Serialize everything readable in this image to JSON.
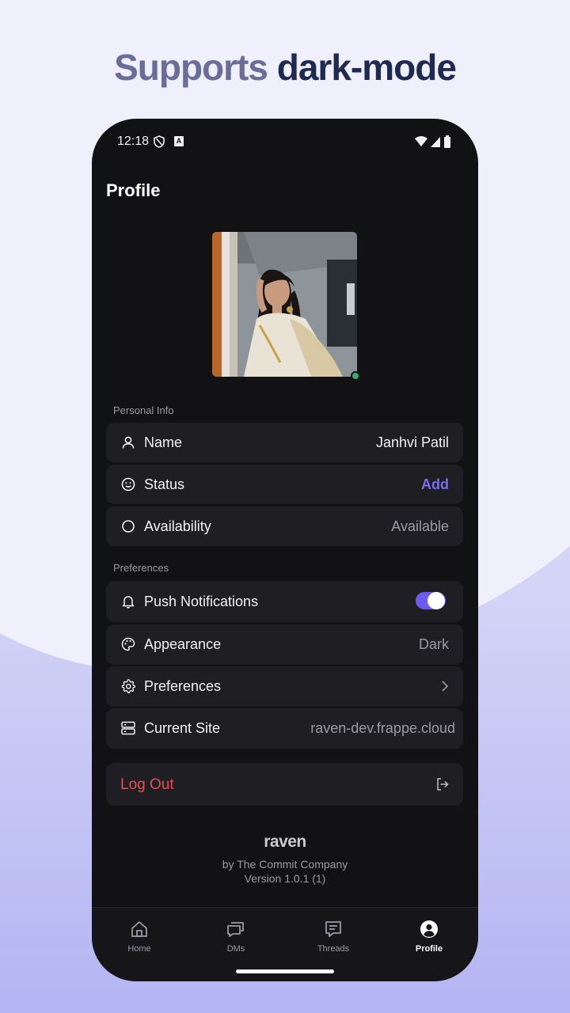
{
  "headline": {
    "part1": "Supports",
    "part2": "dark-mode"
  },
  "status_bar": {
    "time": "12:18",
    "a_badge": "A"
  },
  "page_title": "Profile",
  "personal_info": {
    "label": "Personal Info",
    "rows": [
      {
        "label": "Name",
        "value": "Janhvi Patil",
        "icon": "user-icon"
      },
      {
        "label": "Status",
        "value": "Add",
        "icon": "smile-icon"
      },
      {
        "label": "Availability",
        "value": "Available",
        "icon": "circle-icon"
      }
    ]
  },
  "preferences": {
    "label": "Preferences",
    "rows": [
      {
        "label": "Push Notifications",
        "icon": "bell-icon",
        "toggle_on": true
      },
      {
        "label": "Appearance",
        "value": "Dark",
        "icon": "palette-icon"
      },
      {
        "label": "Preferences",
        "icon": "gear-icon"
      },
      {
        "label": "Current Site",
        "value": "raven-dev.frappe.cloud",
        "icon": "server-icon"
      }
    ]
  },
  "logout": {
    "label": "Log Out",
    "icon": "logout-icon"
  },
  "footer": {
    "brand": "raven",
    "byline": "by The Commit Company",
    "version": "Version 1.0.1 (1)"
  },
  "tabs": [
    {
      "label": "Home",
      "icon": "home-icon"
    },
    {
      "label": "DMs",
      "icon": "dms-icon"
    },
    {
      "label": "Threads",
      "icon": "threads-icon"
    },
    {
      "label": "Profile",
      "icon": "profile-icon",
      "active": true
    }
  ],
  "colors": {
    "accent": "#6a5cf0",
    "danger": "#ef4b4b",
    "online": "#2fb36c",
    "background": "#121214",
    "card": "#1f1f23"
  }
}
